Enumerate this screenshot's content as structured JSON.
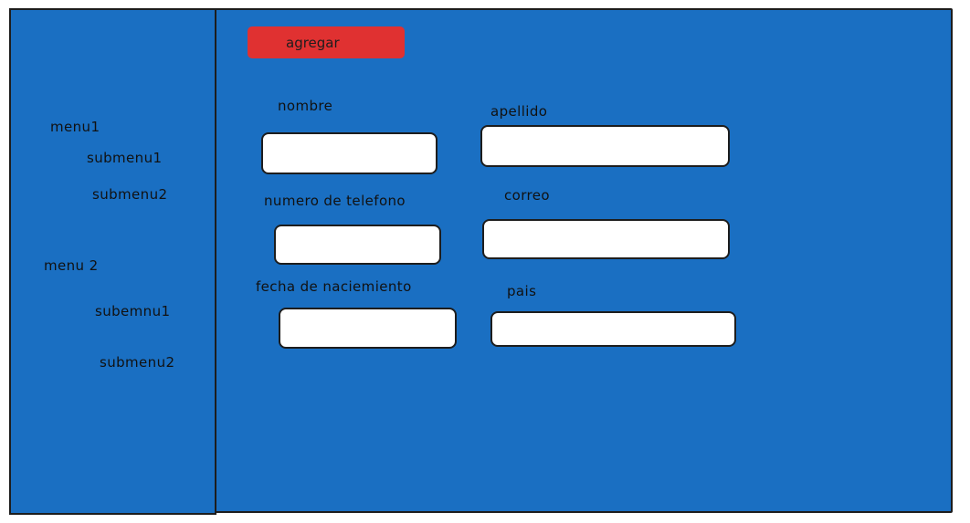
{
  "toolbar": {
    "add_label": "agregar"
  },
  "sidebar": {
    "menus": [
      {
        "label": "menu1",
        "submenus": [
          "submenu1",
          "submenu2"
        ]
      },
      {
        "label": "menu 2",
        "submenus": [
          "subemnu1",
          "submenu2"
        ]
      }
    ]
  },
  "form": {
    "fields": [
      {
        "label": "nombre",
        "value": ""
      },
      {
        "label": "apellido",
        "value": ""
      },
      {
        "label": "numero de telefono",
        "value": ""
      },
      {
        "label": "correo",
        "value": ""
      },
      {
        "label": "fecha de naciemiento",
        "value": ""
      },
      {
        "label": "pais",
        "value": ""
      }
    ]
  },
  "colors": {
    "background": "#1a6fc2",
    "accent_button": "#e03131",
    "input_fill": "#ffffff",
    "stroke": "#1d1d1d"
  }
}
